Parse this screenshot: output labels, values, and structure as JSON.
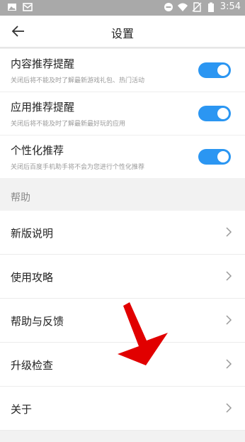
{
  "status_bar": {
    "time": "3:54"
  },
  "header": {
    "title": "设置"
  },
  "toggles": [
    {
      "label": "内容推荐提醒",
      "desc": "关闭后将不能及时了解最新游戏礼包、热门活动",
      "on": true
    },
    {
      "label": "应用推荐提醒",
      "desc": "关闭后将不能及时了解最新最好玩的应用",
      "on": true
    },
    {
      "label": "个性化推荐",
      "desc": "关闭后百度手机助手将不会为您进行个性化推荐",
      "on": true
    }
  ],
  "help_section": {
    "title": "帮助",
    "items": [
      {
        "label": "新版说明"
      },
      {
        "label": "使用攻略"
      },
      {
        "label": "帮助与反馈"
      },
      {
        "label": "升级检查"
      },
      {
        "label": "关于"
      }
    ]
  },
  "colors": {
    "toggle_on": "#2b96f2",
    "annotation_arrow": "#e10000"
  },
  "icons": {
    "status_left": [
      "image-icon",
      "mail-icon"
    ],
    "status_right": [
      "minus-circle-icon",
      "wifi-icon",
      "no-sim-icon",
      "battery-icon"
    ],
    "back": "arrow-left-icon",
    "row": "chevron-right-icon"
  }
}
